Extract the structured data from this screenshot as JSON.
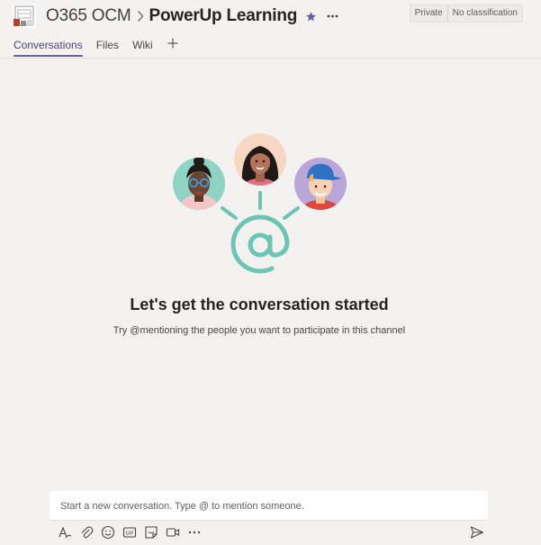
{
  "header": {
    "team_name": "O365 OCM",
    "channel_name": "PowerUp Learning",
    "badges": [
      "Private",
      "No classification"
    ]
  },
  "tabs": [
    {
      "label": "Conversations",
      "active": true
    },
    {
      "label": "Files",
      "active": false
    },
    {
      "label": "Wiki",
      "active": false
    }
  ],
  "empty_state": {
    "headline": "Let's get the conversation started",
    "subtext": "Try @mentioning the people you want to participate in this channel"
  },
  "composer": {
    "placeholder": "Start a new conversation. Type @ to mention someone."
  },
  "toolbar_icons": [
    "format-icon",
    "attach-icon",
    "emoji-icon",
    "gif-icon",
    "sticker-icon",
    "meet-now-icon",
    "more-options-icon"
  ],
  "colors": {
    "accent": "#6264a7",
    "background": "#f3f2f1",
    "illustration_teal": "#6cc4b4"
  }
}
